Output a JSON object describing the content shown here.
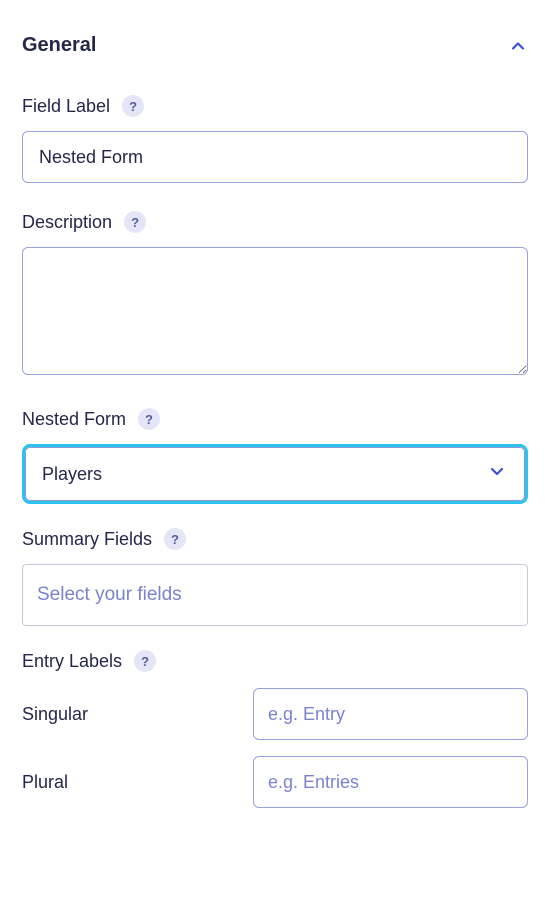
{
  "section": {
    "title": "General"
  },
  "fields": {
    "fieldLabel": {
      "label": "Field Label",
      "value": "Nested Form"
    },
    "description": {
      "label": "Description",
      "value": ""
    },
    "nestedForm": {
      "label": "Nested Form",
      "value": "Players"
    },
    "summaryFields": {
      "label": "Summary Fields",
      "placeholder": "Select your fields"
    },
    "entryLabels": {
      "label": "Entry Labels",
      "singular": {
        "label": "Singular",
        "placeholder": "e.g. Entry",
        "value": ""
      },
      "plural": {
        "label": "Plural",
        "placeholder": "e.g. Entries",
        "value": ""
      }
    }
  },
  "helpGlyph": "?"
}
